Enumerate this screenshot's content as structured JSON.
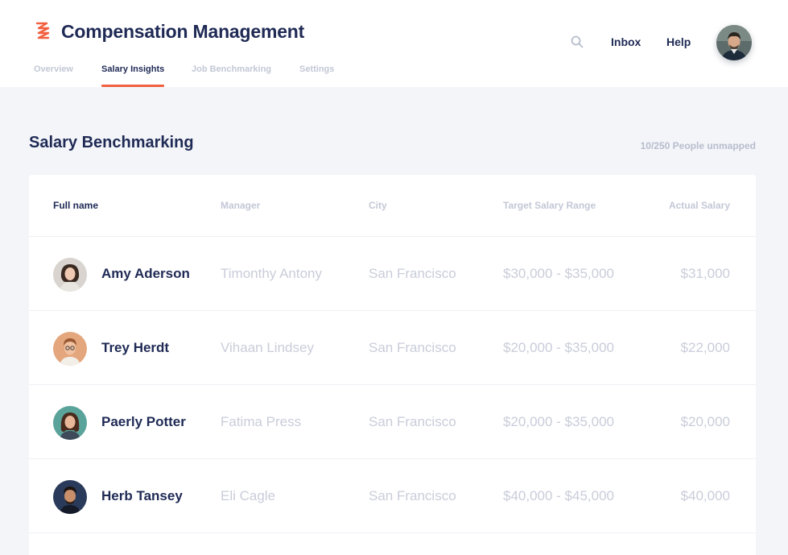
{
  "header": {
    "app_title": "Compensation Management",
    "logo_icon": "zigzag-logo-icon",
    "tabs": [
      {
        "label": "Overview",
        "active": false
      },
      {
        "label": "Salary Insights",
        "active": true
      },
      {
        "label": "Job Benchmarking",
        "active": false
      },
      {
        "label": "Settings",
        "active": false
      }
    ],
    "search_icon": "search-icon",
    "inbox_label": "Inbox",
    "help_label": "Help",
    "accent_color": "#f1603f"
  },
  "main": {
    "section_title": "Salary Benchmarking",
    "unmapped_text": "10/250 People unmapped",
    "table": {
      "columns": [
        "Full name",
        "Manager",
        "City",
        "Target Salary Range",
        "Actual Salary"
      ],
      "rows": [
        {
          "name": "Amy Aderson",
          "manager": "Timonthy Antony",
          "city": "San Francisco",
          "target": "$30,000 - $35,000",
          "actual": "$31,000"
        },
        {
          "name": "Trey Herdt",
          "manager": "Vihaan Lindsey",
          "city": "San Francisco",
          "target": "$20,000 - $35,000",
          "actual": "$22,000"
        },
        {
          "name": "Paerly Potter",
          "manager": "Fatima Press",
          "city": "San Francisco",
          "target": "$20,000 - $35,000",
          "actual": "$20,000"
        },
        {
          "name": "Herb Tansey",
          "manager": "Eli Cagle",
          "city": "San Francisco",
          "target": "$40,000 - $45,000",
          "actual": "$40,000"
        }
      ]
    }
  }
}
